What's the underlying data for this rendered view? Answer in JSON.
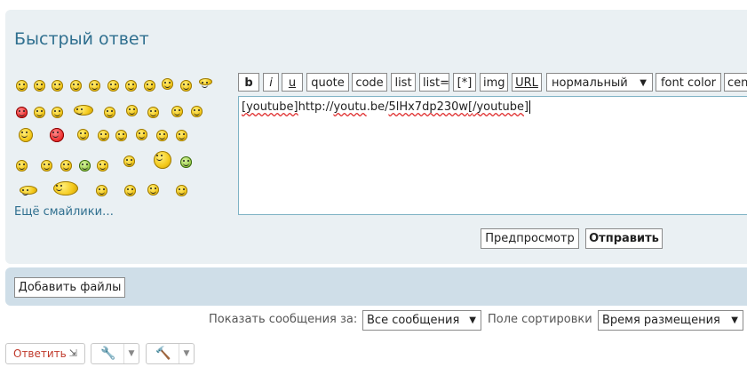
{
  "quick_reply": {
    "title": "Быстрый ответ",
    "more_smileys_link": "Ещё смайлики…",
    "toolbar": {
      "bold": "b",
      "italic": "i",
      "underline": "u",
      "quote": "quote",
      "code": "code",
      "list": "list",
      "list_eq": "list=",
      "list_item": "[*]",
      "img": "img",
      "url": "URL",
      "font_size": "нормальный",
      "font_color": "font color",
      "center": "cen"
    },
    "editor": {
      "tag_open": "[youtube]",
      "url_prefix": "http://",
      "url_host": "youtu",
      "url_mid": ".be/",
      "url_id": "5lHx7dp230w",
      "tag_close_a": "[",
      "tag_close_b": "/youtube",
      "tag_close_c": "]"
    },
    "preview_button": "Предпросмотр",
    "submit_button": "Отправить"
  },
  "attachments": {
    "add_files_button": "Добавить файлы"
  },
  "filters": {
    "show_label": "Показать сообщения за:",
    "show_value": "Все сообщения",
    "sort_label": "Поле сортировки",
    "sort_value": "Время размещения"
  },
  "actions": {
    "reply_label": "Ответить",
    "reply_icon": "reply-arrow-icon",
    "tools_icon": "wrench-icon",
    "moderate_icon": "hammer-icon"
  },
  "smileys_count": 45
}
